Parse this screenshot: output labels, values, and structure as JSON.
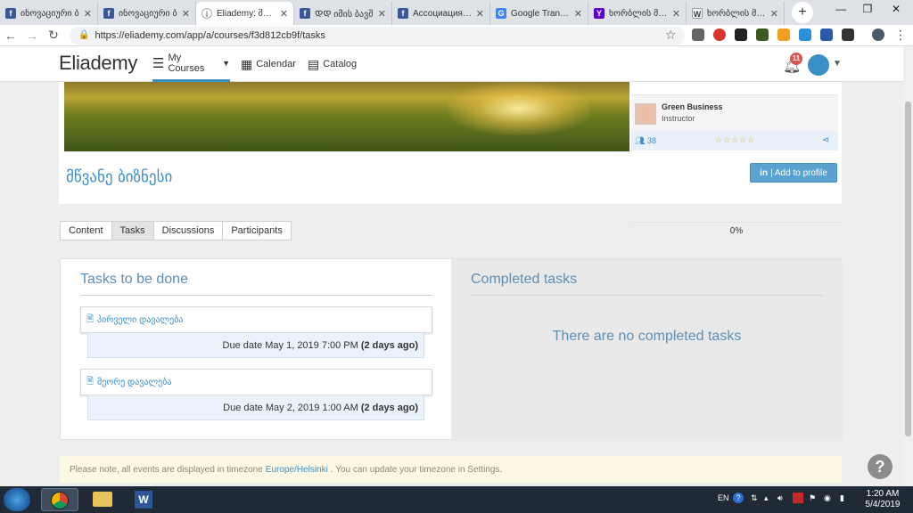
{
  "browser": {
    "tabs": [
      {
        "title": "ინოვაციური ბ",
        "icon": "facebook-icon",
        "color": "#3b5998",
        "glyph": "f"
      },
      {
        "title": "ინოვაციური ბ",
        "icon": "facebook-icon",
        "color": "#3b5998",
        "glyph": "f"
      },
      {
        "title": "Eliademy: მწვა",
        "icon": "eliademy-icon",
        "color": "#777777",
        "glyph": "ⓘ"
      },
      {
        "title": "ᲓᲓ იმის ბავშ",
        "icon": "facebook-icon",
        "color": "#3b5998",
        "glyph": "f"
      },
      {
        "title": "Ассоциация эк",
        "icon": "facebook-icon",
        "color": "#3b5998",
        "glyph": "f"
      },
      {
        "title": "Google Transla",
        "icon": "google-translate-icon",
        "color": "#4285f4",
        "glyph": "G"
      },
      {
        "title": "ხორბლის მარ",
        "icon": "yahoo-icon",
        "color": "#5f01d1",
        "glyph": "Y"
      },
      {
        "title": "ხორბლის მარ",
        "icon": "wikipedia-icon",
        "color": "#555555",
        "glyph": "W"
      }
    ],
    "active_tab": 2,
    "url": "https://eliademy.com/app/a/courses/f3d812cb9f/tasks"
  },
  "site": {
    "logo": "Eliademy",
    "nav": {
      "courses": "My Courses",
      "calendar": "Calendar",
      "catalog": "Catalog"
    },
    "notifications": "11"
  },
  "course": {
    "title": "მწვანე ბიზნესი",
    "instructor_name": "Green Business",
    "instructor_role": "Instructor",
    "participants": "38",
    "rating": "☆☆☆☆☆",
    "add_button": "| Add to profile",
    "add_button_prefix": "in"
  },
  "tabs": {
    "content": "Content",
    "tasks": "Tasks",
    "discussions": "Discussions",
    "participants": "Participants"
  },
  "progress": "0%",
  "todo": {
    "heading": "Tasks to be done",
    "tasks": [
      {
        "title": "პირველი დავალება",
        "due_text": "Due date May 1, 2019 7:00 PM",
        "ago": "(2 days ago)"
      },
      {
        "title": "მეორე დავალება",
        "due_text": "Due date May 2, 2019 1:00 AM",
        "ago": "(2 days ago)"
      }
    ]
  },
  "completed": {
    "heading": "Completed tasks",
    "empty": "There are no completed tasks"
  },
  "note": {
    "prefix": "Please note, all events are displayed in timezone",
    "timezone": "Europe/Helsinki",
    "suffix": ". You can update your timezone in Settings."
  },
  "taskbar": {
    "lang": "EN",
    "time": "1:20 AM",
    "date": "5/4/2019"
  },
  "colors": {
    "accent": "#3a8fc6",
    "badge": "#d9534f",
    "note_bg": "#fcf8e3"
  }
}
